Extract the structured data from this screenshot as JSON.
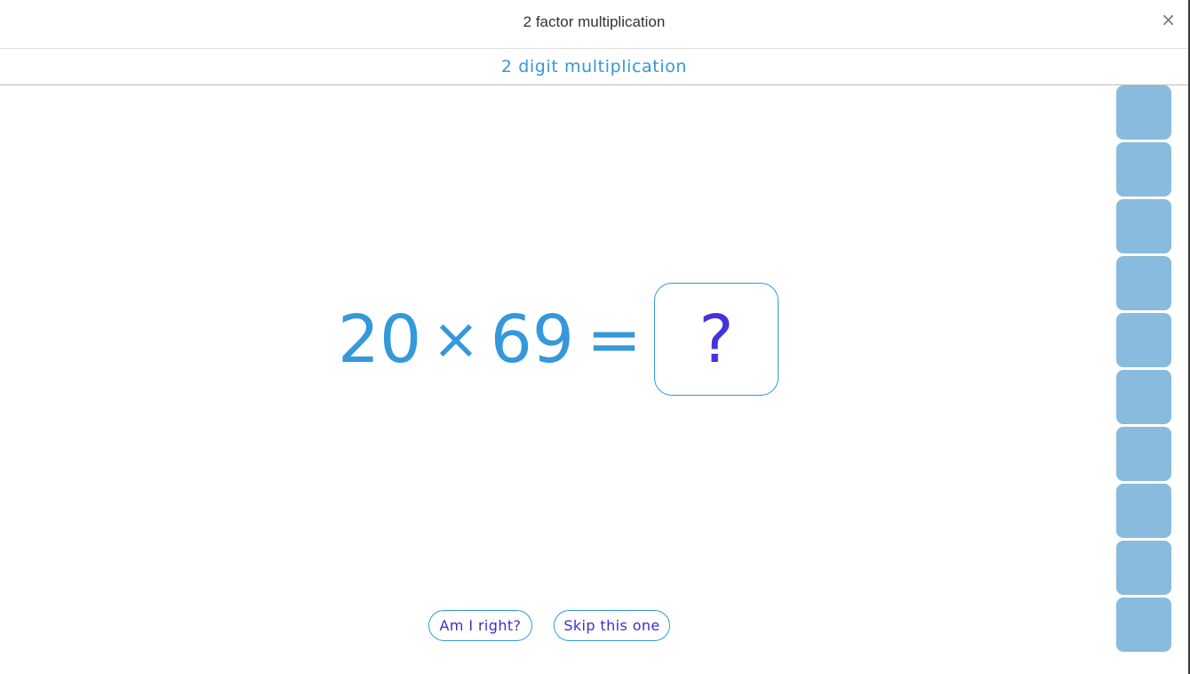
{
  "header": {
    "title": "2 factor multiplication",
    "close_icon": "×"
  },
  "subheader": {
    "title": "2 digit multiplication"
  },
  "problem": {
    "factor_a": "20",
    "operator": "×",
    "factor_b": "69",
    "equals": "=",
    "answer_placeholder": "?"
  },
  "actions": {
    "check_label": "Am I right?",
    "skip_label": "Skip this one"
  },
  "progress": {
    "total_tiles": 10,
    "completed": 0,
    "tile_color": "#88bbdd"
  },
  "colors": {
    "accent": "#3498db",
    "answer_text": "#4433dd",
    "button_text": "#3d2ed0"
  }
}
